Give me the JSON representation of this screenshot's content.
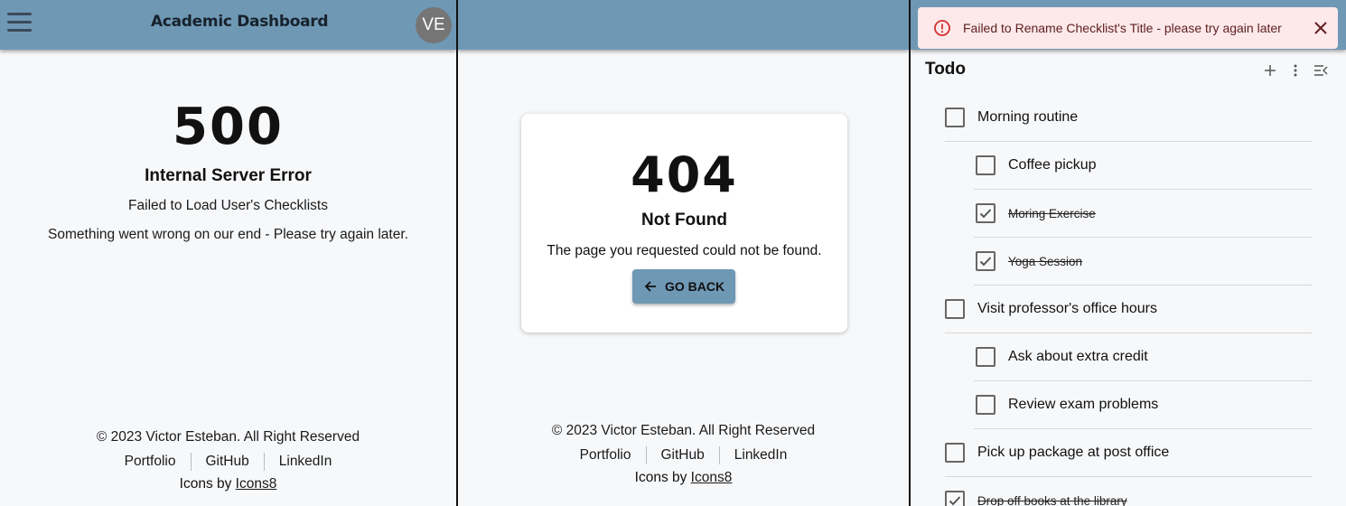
{
  "app": {
    "title": "Academic Dashboard",
    "avatar_initials": "VE"
  },
  "error500": {
    "code": "500",
    "title": "Internal Server Error",
    "line1": "Failed to Load User's Checklists",
    "line2": "Something went wrong on our end - Please try again later."
  },
  "error404": {
    "code": "404",
    "title": "Not Found",
    "message": "The page you requested could not be found.",
    "button_label": "GO BACK"
  },
  "footer": {
    "copyright": "© 2023 Victor Esteban. All Right Reserved",
    "links": [
      "Portfolio",
      "GitHub",
      "LinkedIn"
    ],
    "icons_prefix": "Icons by ",
    "icons_link": "Icons8"
  },
  "alert": {
    "message": "Failed to Rename Checklist's Title - please try again later",
    "severity_color": "#d32f2f"
  },
  "todo": {
    "title": "Todo",
    "items": [
      {
        "label": "Morning routine",
        "checked": false,
        "level": 0
      },
      {
        "label": "Coffee pickup",
        "checked": false,
        "level": 1
      },
      {
        "label": "Moring Exercise",
        "checked": true,
        "level": 1
      },
      {
        "label": "Yoga Session",
        "checked": true,
        "level": 1
      },
      {
        "label": "Visit professor's office hours",
        "checked": false,
        "level": 0
      },
      {
        "label": "Ask about extra credit",
        "checked": false,
        "level": 1
      },
      {
        "label": "Review exam problems",
        "checked": false,
        "level": 1
      },
      {
        "label": "Pick up package at post office",
        "checked": false,
        "level": 0
      },
      {
        "label": "Drop off books at the library",
        "checked": true,
        "level": 0
      }
    ]
  },
  "colors": {
    "appbar": "#6f98b5",
    "alert_bg": "#fde8ea",
    "avatar": "#757575"
  }
}
